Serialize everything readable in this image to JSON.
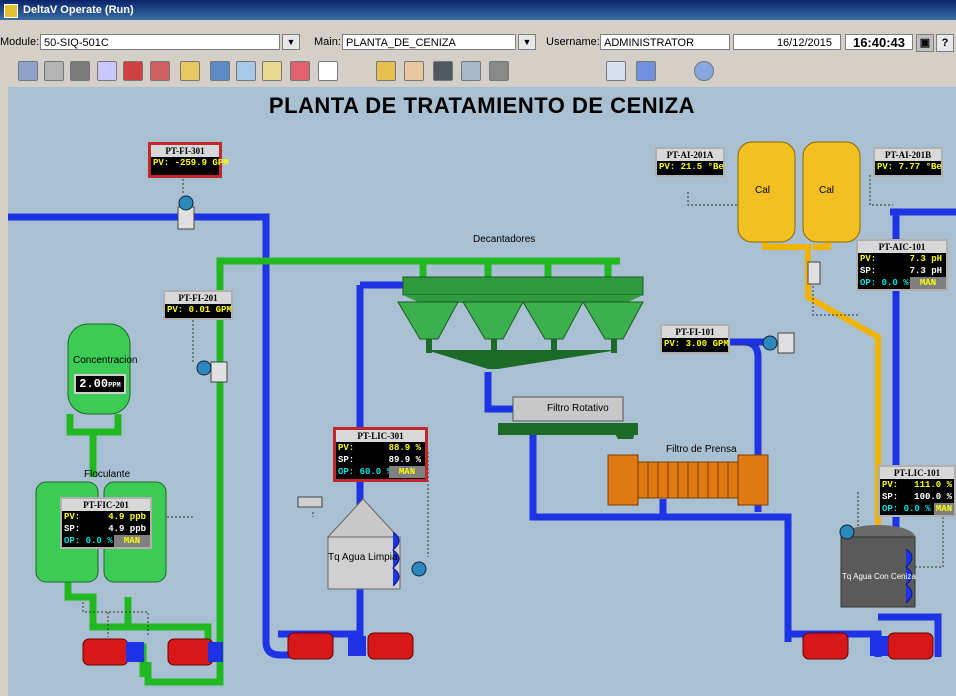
{
  "window": {
    "title": "DeltaV Operate (Run)"
  },
  "infobar": {
    "module_label": "Module:",
    "module_value": "50-SIQ-501C",
    "main_label": "Main:",
    "main_value": "PLANTA_DE_CENIZA",
    "username_label": "Username:",
    "username_value": "ADMINISTRATOR",
    "date": "16/12/2015",
    "time": "16:40:43",
    "help_label": "?"
  },
  "toolbar": {
    "icons": [
      "nav-icon",
      "print-icon",
      "cabinet-icon",
      "trend-icon",
      "grid-icon",
      "alarm-icon",
      "open-folder-icon",
      "back-arrow-icon",
      "display-icon",
      "note-icon",
      "list-icon",
      "report-icon",
      "deltav-icon",
      "users-icon",
      "chart-icon",
      "diagram-icon",
      "config-icon",
      "document-icon",
      "tools-icon",
      "clock-icon"
    ]
  },
  "process": {
    "title": "PLANTA DE TRATAMIENTO DE CENIZA",
    "labels": {
      "decantadores": "Decantadores",
      "filtro_rotativo": "Filtro Rotativo",
      "filtro_prensa": "Filtro de Prensa",
      "concentracion": "Concentracion",
      "floculante": "Floculante",
      "tq_agua_limpia": "Tq Agua Limpia",
      "tq_agua_ceniza": "Tq Agua Con Ceniza",
      "cal1": "Cal",
      "cal2": "Cal"
    },
    "conc_value": "2.00",
    "conc_unit": "PPM",
    "faceplates": {
      "fi301": {
        "tag": "PT-FI-301",
        "pv_label": "PV:",
        "pv": "-259.9",
        "unit": "GPM"
      },
      "fi201": {
        "tag": "PT-FI-201",
        "pv_label": "PV:",
        "pv": "0.01",
        "unit": "GPM"
      },
      "fi101": {
        "tag": "PT-FI-101",
        "pv_label": "PV:",
        "pv": "3.00",
        "unit": "GPM"
      },
      "ai201a": {
        "tag": "PT-AI-201A",
        "pv_label": "PV:",
        "pv": "21.5",
        "unit": "°Be"
      },
      "ai201b": {
        "tag": "PT-AI-201B",
        "pv_label": "PV:",
        "pv": "7.77",
        "unit": "°Be"
      },
      "aic101": {
        "tag": "PT-AIC-101",
        "pv_label": "PV:",
        "pv": "7.3",
        "sp_label": "SP:",
        "sp": "7.3",
        "unit": "pH",
        "op_label": "OP:",
        "op": "0.0",
        "op_unit": "%",
        "mode": "MAN"
      },
      "lic301": {
        "tag": "PT-LIC-301",
        "pv_label": "PV:",
        "pv": "88.9",
        "sp_label": "SP:",
        "sp": "89.9",
        "unit": "%",
        "op_label": "OP:",
        "op": "60.0",
        "op_unit": "%",
        "mode": "MAN"
      },
      "fic201": {
        "tag": "PT-FIC-201",
        "pv_label": "PV:",
        "pv": "4.9",
        "sp_label": "SP:",
        "sp": "4.9",
        "unit": "ppb",
        "op_label": "OP:",
        "op": "0.0",
        "op_unit": "%",
        "mode": "MAN"
      },
      "lic101": {
        "tag": "PT-LIC-101",
        "pv_label": "PV:",
        "pv": "111.0",
        "sp_label": "SP:",
        "sp": "100.0",
        "unit": "%",
        "op_label": "OP:",
        "op": "0.0",
        "op_unit": "%",
        "mode": "MAN"
      }
    }
  },
  "colors": {
    "background": "#a9c0d2",
    "pipe_blue": "#1e32e6",
    "pipe_green": "#22b822",
    "pipe_yellow": "#f0b400",
    "alarm_red": "#c0282a"
  }
}
